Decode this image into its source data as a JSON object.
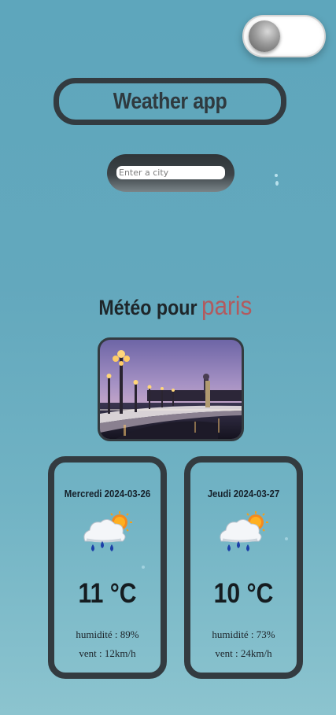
{
  "header": {
    "theme_toggle_state": "off",
    "title": "Weather app"
  },
  "search": {
    "placeholder": "Enter a city",
    "value": ""
  },
  "weather": {
    "heading_prefix": "Météo pour",
    "city": "paris",
    "photo_icon": "paris-bridge-photo",
    "forecast": [
      {
        "date": "Mercredi 2024-03-26",
        "icon": "rain-cloud-sun-icon",
        "temperature": "11 °C",
        "humidity": "humidité : 89%",
        "wind": "vent : 12km/h"
      },
      {
        "date": "Jeudi 2024-03-27",
        "icon": "rain-cloud-sun-icon",
        "temperature": "10 °C",
        "humidity": "humidité : 73%",
        "wind": "vent : 24km/h"
      }
    ]
  },
  "colors": {
    "background": "#63a8bd",
    "frame": "#333b40",
    "city_accent": "#b25a5e"
  }
}
